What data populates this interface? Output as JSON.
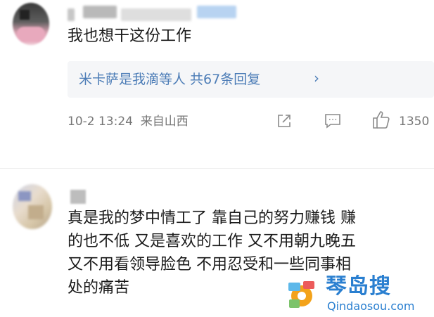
{
  "comment1": {
    "text": "我也想干这份工作",
    "reply_summary": "米卡萨是我滴等人  共67条回复",
    "reply_chevron": "›",
    "timestamp": "10-2 13:24",
    "location": "来自山西",
    "like_count": "1350"
  },
  "comment2": {
    "lines": [
      "真是我的梦中情工了 靠自己的努力赚钱 赚",
      "的也不低 又是喜欢的工作 又不用朝九晚五",
      "又不用看领导脸色 不用忍受和一些同事相",
      "处的痛苦"
    ]
  },
  "watermark": {
    "title": "琴岛搜",
    "url": "Qindaosou.com"
  },
  "colors": {
    "link_blue": "#4d7db7",
    "watermark_blue": "#2a7fd0"
  },
  "icons": [
    "share-icon",
    "comment-icon",
    "like-icon",
    "chevron-right-icon"
  ]
}
